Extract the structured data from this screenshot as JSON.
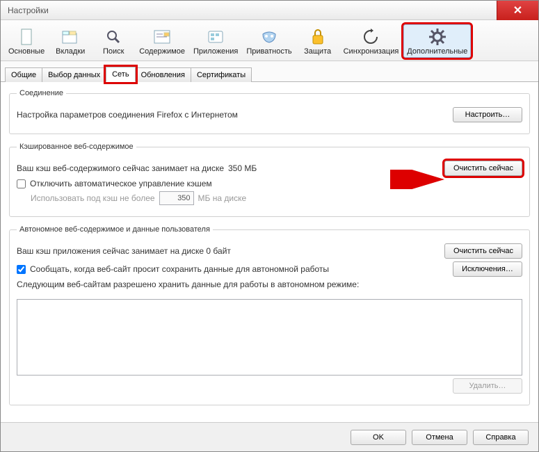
{
  "window_title": "Настройки",
  "toolbar_items": [
    {
      "id": "general",
      "label": "Основные"
    },
    {
      "id": "tabs",
      "label": "Вкладки"
    },
    {
      "id": "search",
      "label": "Поиск"
    },
    {
      "id": "content",
      "label": "Содержимое"
    },
    {
      "id": "apps",
      "label": "Приложения"
    },
    {
      "id": "privacy",
      "label": "Приватность"
    },
    {
      "id": "security",
      "label": "Защита"
    },
    {
      "id": "sync",
      "label": "Синхронизация"
    },
    {
      "id": "advanced",
      "label": "Дополнительные",
      "active": true
    }
  ],
  "tabs": [
    {
      "id": "general2",
      "label": "Общие"
    },
    {
      "id": "data-choices",
      "label": "Выбор данных"
    },
    {
      "id": "network",
      "label": "Сеть",
      "active": true
    },
    {
      "id": "updates",
      "label": "Обновления"
    },
    {
      "id": "certs",
      "label": "Сертификаты"
    }
  ],
  "connection": {
    "legend": "Соединение",
    "text": "Настройка параметров соединения Firefox с Интернетом",
    "button": "Настроить…"
  },
  "cache": {
    "legend": "Кэшированное веб-содержимое",
    "text_pre": "Ваш кэш веб-содержимого сейчас занимает на диске ",
    "size": "350 МБ",
    "clear_button": "Очистить сейчас",
    "override_label": "Отключить автоматическое управление кэшем",
    "override_checked": false,
    "limit_label_pre": "Использовать под кэш не более",
    "limit_value": "350",
    "limit_label_post": "МБ на диске"
  },
  "offline": {
    "legend": "Автономное веб-содержимое и данные пользователя",
    "text": "Ваш кэш приложения сейчас занимает на диске 0 байт",
    "clear_button": "Очистить сейчас",
    "notify_checked": true,
    "notify_label": "Сообщать, когда веб-сайт просит сохранить данные для автономной работы",
    "exceptions_button": "Исключения…",
    "sites_label": "Следующим веб-сайтам разрешено хранить данные для работы в автономном режиме:",
    "remove_button": "Удалить…"
  },
  "buttons": {
    "ok": "OK",
    "cancel": "Отмена",
    "help": "Справка"
  }
}
